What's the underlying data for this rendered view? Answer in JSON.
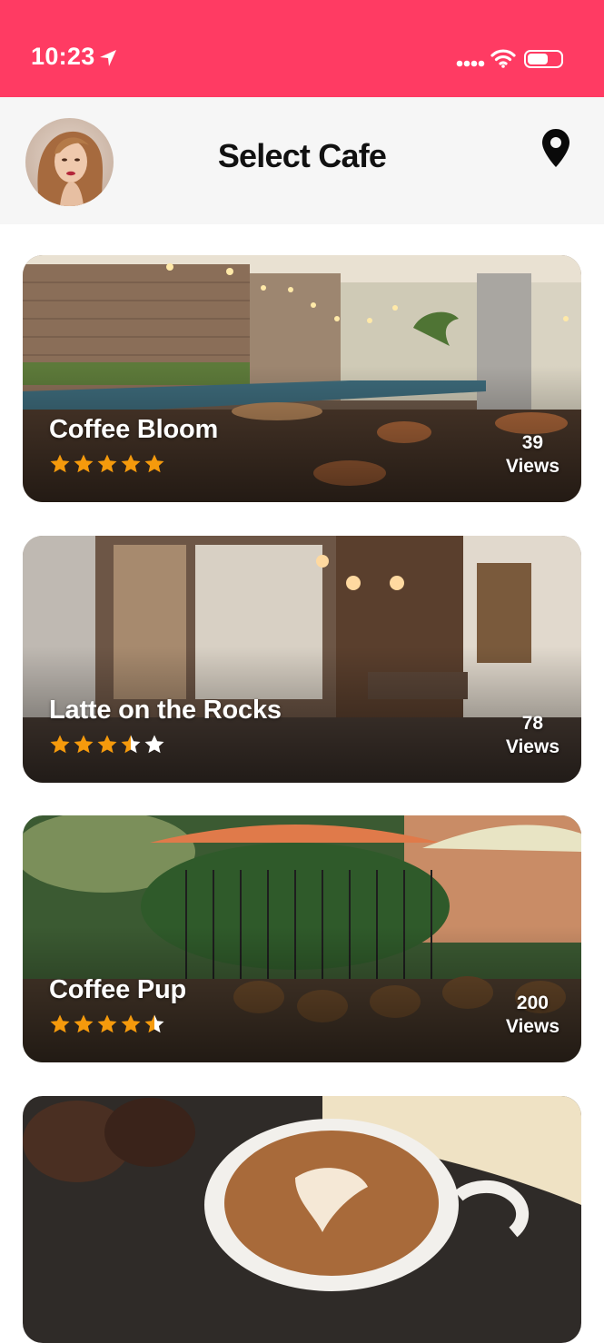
{
  "status": {
    "time": "10:23"
  },
  "header": {
    "title": "Select Cafe"
  },
  "cafes": [
    {
      "name": "Coffee Bloom",
      "rating": 5,
      "views_count": "39",
      "views_label": "Views"
    },
    {
      "name": "Latte on the Rocks",
      "rating": 3.5,
      "views_count": "78",
      "views_label": "Views"
    },
    {
      "name": "Coffee Pup",
      "rating": 4.5,
      "views_count": "200",
      "views_label": "Views"
    },
    {
      "name": "",
      "rating": null,
      "views_count": "",
      "views_label": ""
    }
  ],
  "colors": {
    "brand": "#ff3b63",
    "star": "#f59a0c",
    "header_bg": "#f6f6f6"
  },
  "icons": {
    "location_arrow": "location-arrow-icon",
    "wifi": "wifi-icon",
    "battery": "battery-icon",
    "map_pin": "map-pin-icon",
    "star": "star-icon"
  }
}
